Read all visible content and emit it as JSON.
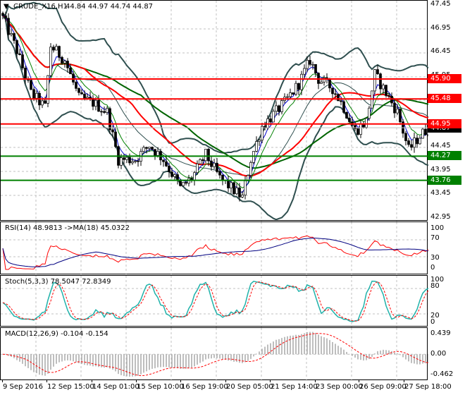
{
  "header": {
    "symbol": "CRUDE_X16,H1",
    "ohlc": "44.84 44.97 44.74 44.87"
  },
  "price_axis": [
    "47.45",
    "46.95",
    "46.45",
    "45.95",
    "45.45",
    "44.95",
    "44.45",
    "43.95",
    "43.45",
    "42.95"
  ],
  "levels": [
    {
      "value": "45.90",
      "color": "#ff0000"
    },
    {
      "value": "45.48",
      "color": "#ff0000"
    },
    {
      "value": "44.95",
      "color": "#ff0000"
    },
    {
      "value": "44.27",
      "color": "#008000"
    },
    {
      "value": "43.76",
      "color": "#008000"
    }
  ],
  "current_price": "44.87",
  "rsi": {
    "label": "RSI(14) 48.9813  ->MA(18) 45.0322",
    "axis": [
      "100",
      "70",
      "30",
      "0"
    ]
  },
  "stoch": {
    "label": "Stoch(5,3,3) 78.5047 72.8349",
    "axis": [
      "100",
      "80",
      "20",
      "0"
    ]
  },
  "macd": {
    "label": "MACD(12,26,9) -0.104 -0.154",
    "axis": [
      "0.439",
      "0.00",
      "-0.462"
    ]
  },
  "time_axis": [
    "9 Sep 2016",
    "12 Sep 15:00",
    "14 Sep 01:00",
    "15 Sep 10:00",
    "16 Sep 19:00",
    "20 Sep 05:00",
    "21 Sep 14:00",
    "23 Sep 00:00",
    "26 Sep 09:00",
    "27 Sep 18:00"
  ],
  "chart_data": {
    "type": "candlestick",
    "price_range": [
      42.95,
      47.45
    ],
    "close_keypoints_bar_price": [
      [
        0,
        47.2
      ],
      [
        5,
        46.5
      ],
      [
        10,
        45.6
      ],
      [
        15,
        45.3
      ],
      [
        17,
        46.6
      ],
      [
        22,
        46.3
      ],
      [
        27,
        45.5
      ],
      [
        32,
        45.4
      ],
      [
        37,
        45.2
      ],
      [
        41,
        44.2
      ],
      [
        47,
        44.2
      ],
      [
        52,
        44.5
      ],
      [
        57,
        44.2
      ],
      [
        63,
        43.6
      ],
      [
        67,
        43.8
      ],
      [
        72,
        44.3
      ],
      [
        77,
        43.8
      ],
      [
        85,
        43.4
      ],
      [
        88,
        44.2
      ],
      [
        92,
        44.9
      ],
      [
        100,
        45.4
      ],
      [
        105,
        45.8
      ],
      [
        109,
        46.3
      ],
      [
        112,
        45.9
      ],
      [
        117,
        45.7
      ],
      [
        121,
        45.3
      ],
      [
        125,
        44.8
      ],
      [
        129,
        45.0
      ],
      [
        132,
        46.0
      ],
      [
        136,
        45.6
      ],
      [
        140,
        45.2
      ],
      [
        144,
        44.4
      ],
      [
        148,
        44.7
      ],
      [
        151,
        44.87
      ]
    ],
    "bars": 152
  }
}
